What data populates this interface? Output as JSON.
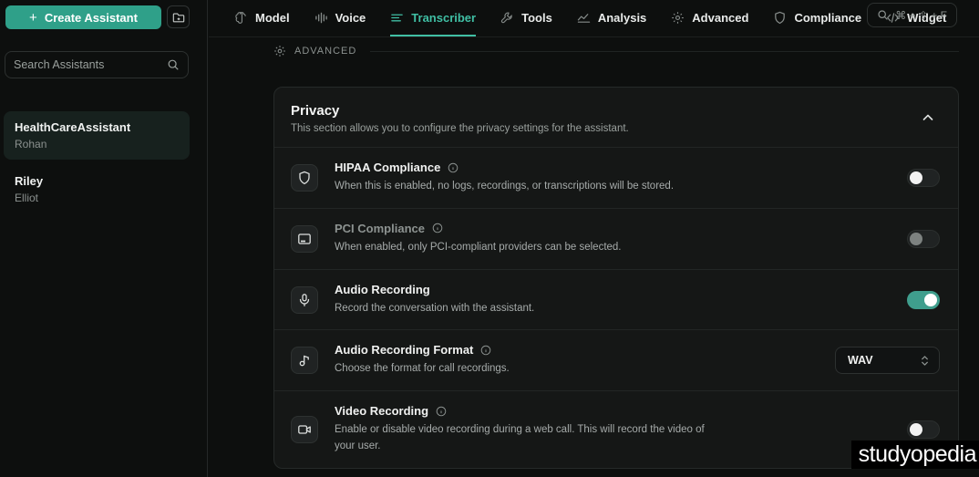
{
  "colors": {
    "background": "#0d0f0e",
    "accent_teal": "#2fa089",
    "active_tab_teal": "#40bfa4",
    "toggle_on_teal": "#3f9e8d",
    "card_background": "#151716",
    "watermark_background": "#000000"
  },
  "sidebar": {
    "create_button_label": "Create Assistant",
    "create_button_plus": "+",
    "search_placeholder": "Search Assistants",
    "assistants": [
      {
        "name": "HealthCareAssistant",
        "subtitle": "Rohan",
        "selected": true
      },
      {
        "name": "Riley",
        "subtitle": "Elliot",
        "selected": false
      }
    ]
  },
  "tabs": [
    {
      "label": "Model",
      "icon": "brain-icon",
      "active": false
    },
    {
      "label": "Voice",
      "icon": "waveform-icon",
      "active": false
    },
    {
      "label": "Transcriber",
      "icon": "transcript-lines-icon",
      "active": true
    },
    {
      "label": "Tools",
      "icon": "wrench-icon",
      "active": false
    },
    {
      "label": "Analysis",
      "icon": "trend-chart-icon",
      "active": false
    },
    {
      "label": "Advanced",
      "icon": "gear-icon",
      "active": false
    },
    {
      "label": "Compliance",
      "icon": "shield-icon",
      "active": false
    },
    {
      "label": "Widget",
      "icon": "code-icon",
      "active": false
    }
  ],
  "search_shortcut": "⌘ + ⇧ + F",
  "section_label": "ADVANCED",
  "privacy": {
    "title": "Privacy",
    "subtitle": "This section allows you to configure the privacy settings for the assistant.",
    "settings": [
      {
        "title": "HIPAA Compliance",
        "description": "When this is enabled, no logs, recordings, or transcriptions will be stored.",
        "icon": "shield-icon",
        "control": "toggle",
        "state": "off",
        "has_info": true,
        "disabled": false
      },
      {
        "title": "PCI Compliance",
        "description": "When enabled, only PCI-compliant providers can be selected.",
        "icon": "card-icon",
        "control": "toggle",
        "state": "off",
        "has_info": true,
        "disabled": true
      },
      {
        "title": "Audio Recording",
        "description": "Record the conversation with the assistant.",
        "icon": "microphone-icon",
        "control": "toggle",
        "state": "on",
        "has_info": false,
        "disabled": false
      },
      {
        "title": "Audio Recording Format",
        "description": "Choose the format for call recordings.",
        "icon": "music-note-icon",
        "control": "select",
        "value": "WAV",
        "has_info": true,
        "disabled": false
      },
      {
        "title": "Video Recording",
        "description": "Enable or disable video recording during a web call. This will record the video of your user.",
        "icon": "video-camera-icon",
        "control": "toggle",
        "state": "off",
        "has_info": true,
        "disabled": false
      }
    ]
  },
  "watermark": "studyopedia"
}
